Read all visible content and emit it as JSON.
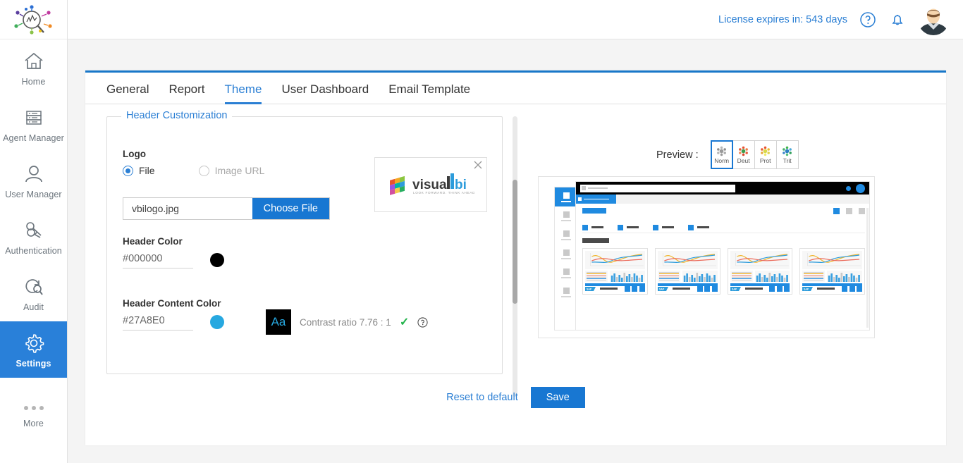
{
  "app": {
    "logo_icon": "analytics-magnifier-logo"
  },
  "header": {
    "license_text": "License expires in: 543 days",
    "help_icon": "help-circle-icon",
    "notification_icon": "bell-icon",
    "avatar_icon": "user-avatar"
  },
  "sidebar": {
    "items": [
      {
        "label": "Home",
        "icon": "home-icon",
        "active": false
      },
      {
        "label": "Agent Manager",
        "icon": "server-rack-icon",
        "active": false
      },
      {
        "label": "User Manager",
        "icon": "user-icon",
        "active": false
      },
      {
        "label": "Authentication",
        "icon": "keys-icon",
        "active": false
      },
      {
        "label": "Audit",
        "icon": "audit-search-icon",
        "active": false
      },
      {
        "label": "Settings",
        "icon": "gear-icon",
        "active": true
      }
    ],
    "more_label": "More",
    "more_icon": "ellipsis-icon"
  },
  "tabs": [
    {
      "label": "General",
      "active": false
    },
    {
      "label": "Report",
      "active": false
    },
    {
      "label": "Theme",
      "active": true
    },
    {
      "label": "User Dashboard",
      "active": false
    },
    {
      "label": "Email Template",
      "active": false
    }
  ],
  "fieldset": {
    "legend": "Header Customization",
    "logo_label": "Logo",
    "radio_file": "File",
    "radio_image_url": "Image URL",
    "file_name": "vbilogo.jpg",
    "choose_file_label": "Choose File",
    "header_color_label": "Header Color",
    "header_color_value": "#000000",
    "header_content_color_label": "Header Content Color",
    "header_content_color_value": "#27A8E0",
    "aa_sample": "Aa",
    "contrast_text": "Contrast ratio 7.76 : 1",
    "contrast_check": "✓",
    "contrast_help_icon": "help-circle-icon",
    "logo_close_icon": "close-icon",
    "logo_alt": "visualbi",
    "logo_wordmark_1": "visua",
    "logo_wordmark_2": "l",
    "logo_wordmark_3": "bi",
    "logo_tagline": "LOOK FORWARD. THINK AHEAD."
  },
  "preview": {
    "label": "Preview :",
    "modes": [
      {
        "label": "Norm",
        "icon": "vision-normal-icon",
        "active": true
      },
      {
        "label": "Deut",
        "icon": "vision-deuteranopia-icon",
        "active": false
      },
      {
        "label": "Prot",
        "icon": "vision-protanopia-icon",
        "active": false
      },
      {
        "label": "Trit",
        "icon": "vision-tritanopia-icon",
        "active": false
      }
    ],
    "mock": {
      "sidebar_item_count": 6,
      "card_count": 4,
      "filter_count": 4,
      "toolbar_icon_count": 3
    }
  },
  "footer": {
    "reset_label": "Reset to default",
    "save_label": "Save"
  },
  "colors": {
    "accent_blue": "#1877d2",
    "link_blue": "#2b7fd4",
    "header_color": "#000000",
    "header_content_color": "#27A8E0",
    "check_green": "#21b34a"
  }
}
